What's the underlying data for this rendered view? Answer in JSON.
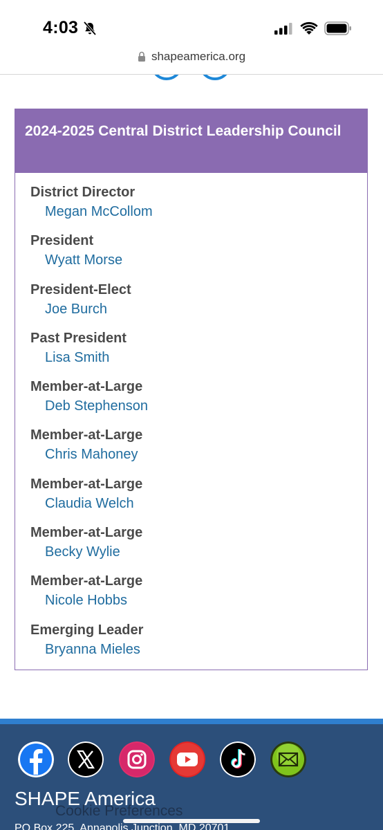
{
  "status_bar": {
    "time": "4:03",
    "icons": [
      "bell-slash-icon",
      "cellular-signal-icon",
      "wifi-icon",
      "battery-icon"
    ]
  },
  "browser": {
    "url": "shapeamerica.org",
    "lock_icon": "lock-icon"
  },
  "council": {
    "title": "2024-2025 Central District Leadership Council",
    "header_color": "#8a6bb1",
    "link_color": "#1f6c9f",
    "roles": [
      {
        "title": "District Director",
        "name": "Megan McCollom"
      },
      {
        "title": "President",
        "name": "Wyatt Morse"
      },
      {
        "title": "President-Elect",
        "name": "Joe Burch"
      },
      {
        "title": "Past President",
        "name": "Lisa Smith"
      },
      {
        "title": "Member-at-Large",
        "name": "Deb Stephenson"
      },
      {
        "title": "Member-at-Large",
        "name": "Chris Mahoney"
      },
      {
        "title": "Member-at-Large",
        "name": "Claudia Welch"
      },
      {
        "title": "Member-at-Large",
        "name": "Becky Wylie"
      },
      {
        "title": "Member-at-Large",
        "name": "Nicole Hobbs"
      },
      {
        "title": "Emerging Leader",
        "name": "Bryanna Mieles"
      }
    ]
  },
  "footer": {
    "background": "#2c4f7a",
    "social_icons": [
      "facebook-icon",
      "x-icon",
      "instagram-icon",
      "youtube-icon",
      "tiktok-icon",
      "email-icon"
    ],
    "org_name": "SHAPE America",
    "cookie_preferences": "Cookie Preferences",
    "address": "PO Box 225, Annapolis Junction, MD 20701"
  }
}
